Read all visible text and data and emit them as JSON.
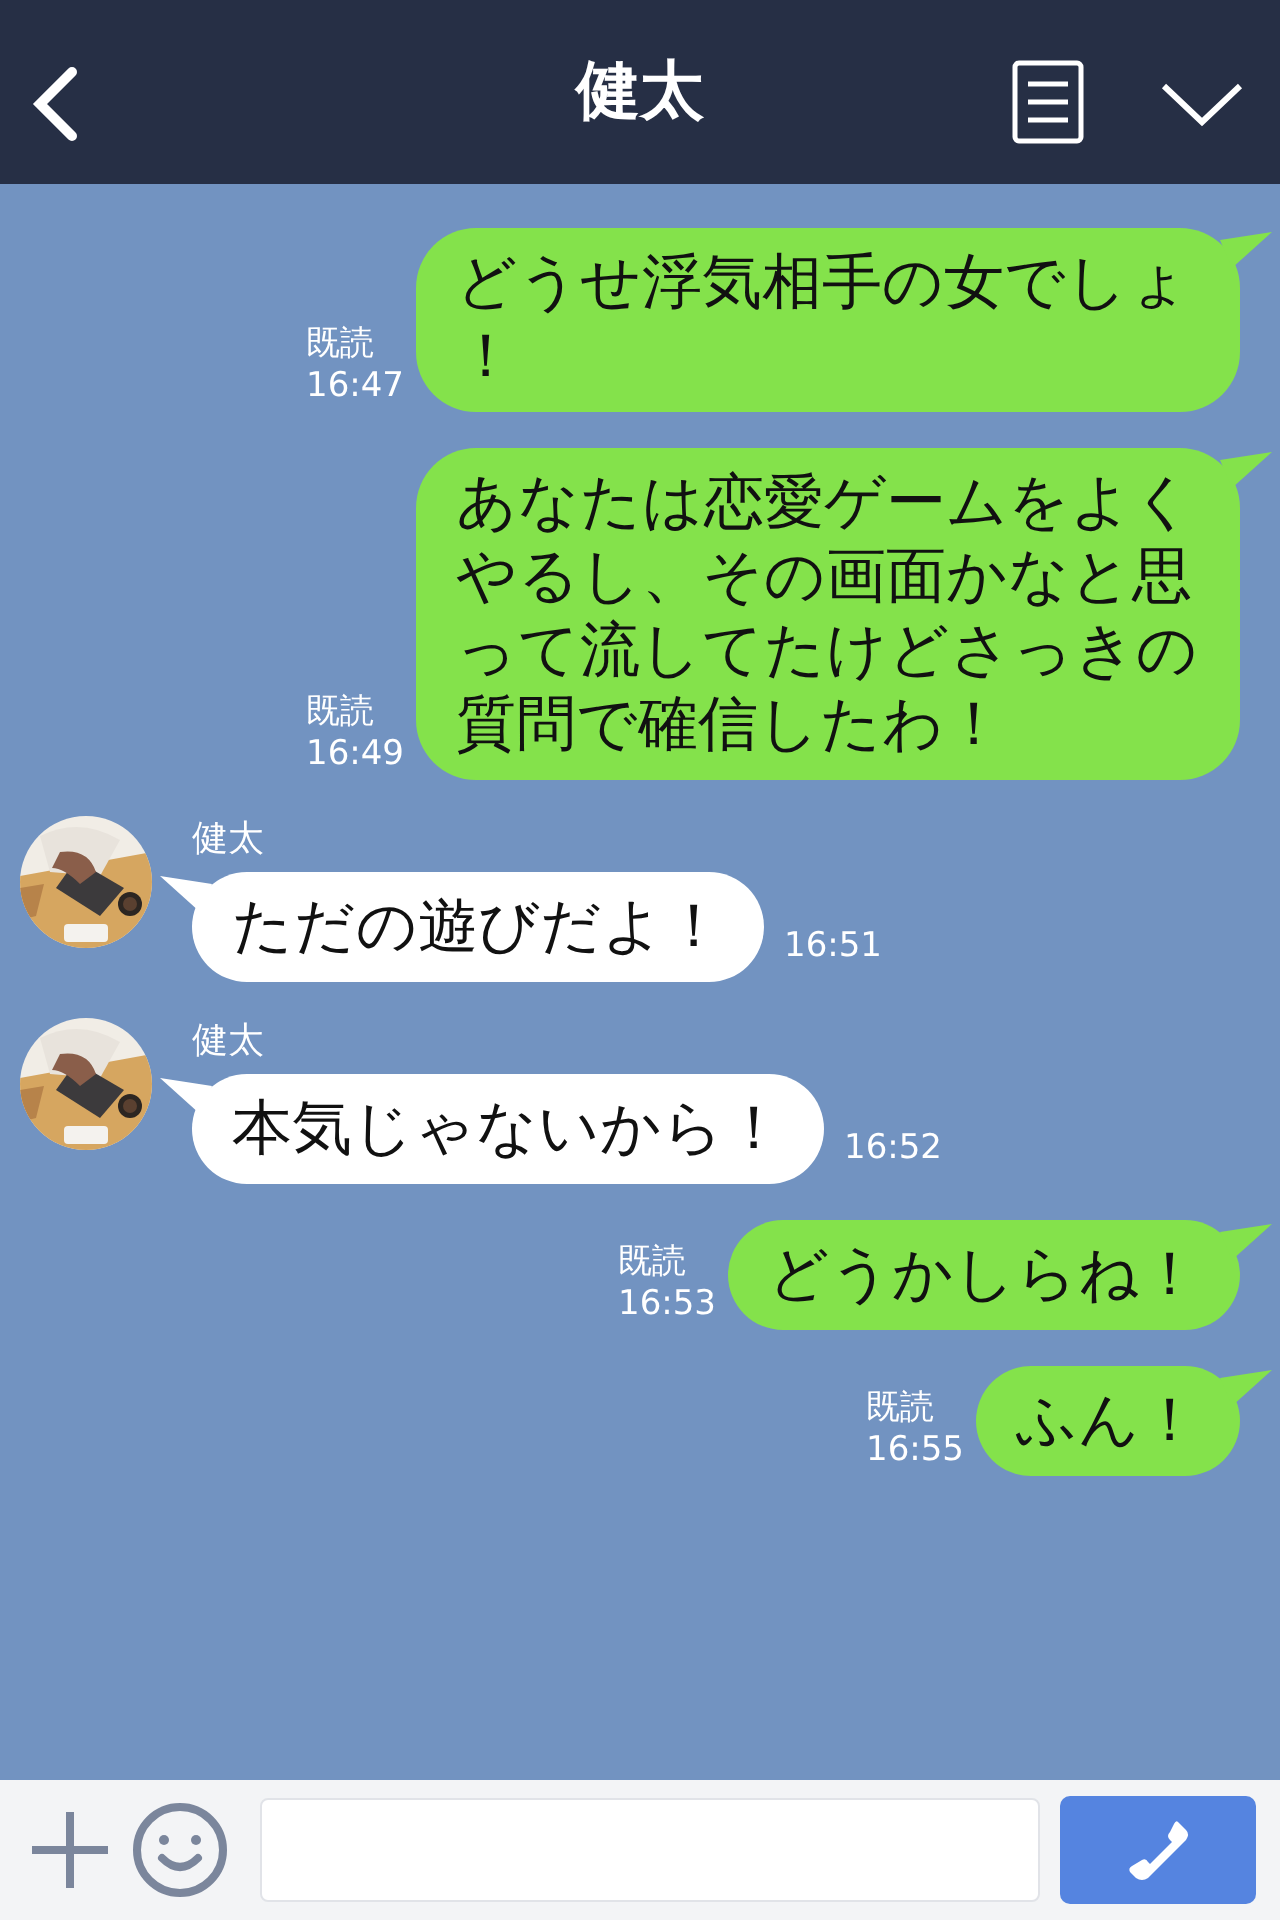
{
  "header": {
    "title": "健太"
  },
  "messages": [
    {
      "kind": "sent",
      "read": "既読",
      "time": "16:47",
      "text": "どうせ浮気相手の女でしょ！"
    },
    {
      "kind": "sent",
      "read": "既読",
      "time": "16:49",
      "text": "あなたは恋愛ゲームをよくやるし、その画面かなと思って流してたけどさっきの質問で確信したわ！"
    },
    {
      "kind": "received",
      "sender": "健太",
      "time": "16:51",
      "text": "ただの遊びだよ！"
    },
    {
      "kind": "received",
      "sender": "健太",
      "time": "16:52",
      "text": "本気じゃないから！"
    },
    {
      "kind": "sent",
      "read": "既読",
      "time": "16:53",
      "text": "どうかしらね！"
    },
    {
      "kind": "sent",
      "read": "既読",
      "time": "16:55",
      "text": "ふん！"
    }
  ]
}
